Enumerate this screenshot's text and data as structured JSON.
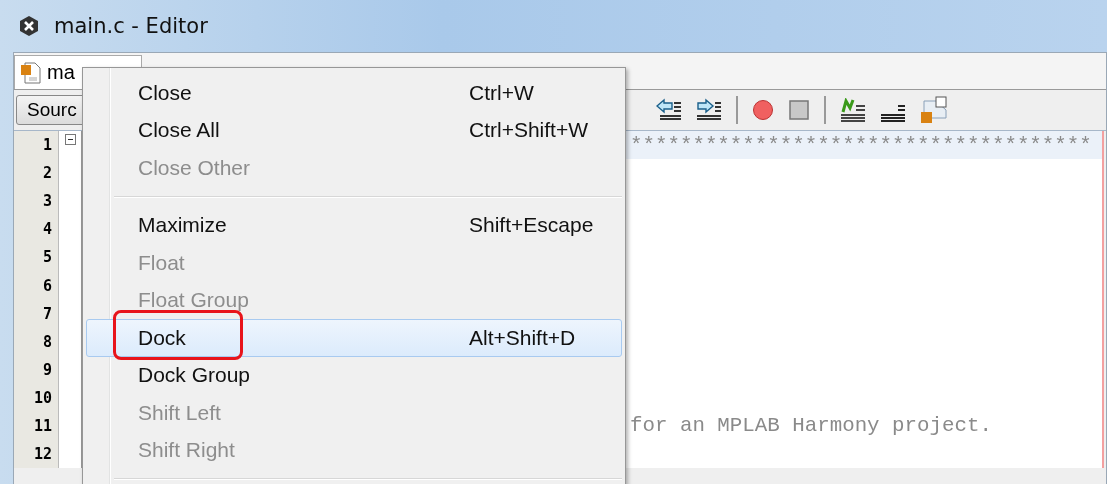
{
  "window": {
    "title": "main.c - Editor"
  },
  "tabs": [
    {
      "label": "ma",
      "selected": true
    }
  ],
  "toolbar": {
    "source_button": "Sourc"
  },
  "editor": {
    "lines": [
      {
        "number": "1",
        "text": "*************************************",
        "highlighted": true,
        "fold": true
      },
      {
        "number": "2",
        "highlighted": false,
        "fold": false
      },
      {
        "number": "3",
        "highlighted": false,
        "fold": false
      },
      {
        "number": "4",
        "highlighted": false,
        "fold": false
      },
      {
        "number": "5",
        "highlighted": false,
        "fold": false
      },
      {
        "number": "6",
        "highlighted": false,
        "fold": false
      },
      {
        "number": "7",
        "highlighted": false,
        "fold": false
      },
      {
        "number": "8",
        "highlighted": false,
        "fold": false
      },
      {
        "number": "9",
        "highlighted": false,
        "fold": false
      },
      {
        "number": "10",
        "highlighted": false,
        "fold": false
      },
      {
        "number": "11",
        "text": "for an MPLAB Harmony project.",
        "highlighted": false,
        "fold": false
      },
      {
        "number": "12",
        "highlighted": false,
        "fold": false
      }
    ]
  },
  "context_menu": {
    "items": [
      {
        "kind": "item",
        "label": "Close",
        "shortcut": "Ctrl+W",
        "disabled": false,
        "selected": false,
        "annotated": false
      },
      {
        "kind": "item",
        "label": "Close All",
        "shortcut": "Ctrl+Shift+W",
        "disabled": false,
        "selected": false,
        "annotated": false
      },
      {
        "kind": "item",
        "label": "Close Other",
        "disabled": true,
        "selected": false,
        "annotated": false
      },
      {
        "kind": "separator"
      },
      {
        "kind": "item",
        "label": "Maximize",
        "shortcut": "Shift+Escape",
        "disabled": false,
        "selected": false,
        "annotated": false
      },
      {
        "kind": "item",
        "label": "Float",
        "disabled": true,
        "selected": false,
        "annotated": false
      },
      {
        "kind": "item",
        "label": "Float Group",
        "disabled": true,
        "selected": false,
        "annotated": false
      },
      {
        "kind": "item",
        "label": "Dock",
        "shortcut": "Alt+Shift+D",
        "disabled": false,
        "selected": true,
        "annotated": true
      },
      {
        "kind": "item",
        "label": "Dock Group",
        "disabled": false,
        "selected": false,
        "annotated": false
      },
      {
        "kind": "item",
        "label": "Shift Left",
        "disabled": true,
        "selected": false,
        "annotated": false
      },
      {
        "kind": "item",
        "label": "Shift Right",
        "disabled": true,
        "selected": false,
        "annotated": false
      },
      {
        "kind": "separator"
      }
    ]
  }
}
